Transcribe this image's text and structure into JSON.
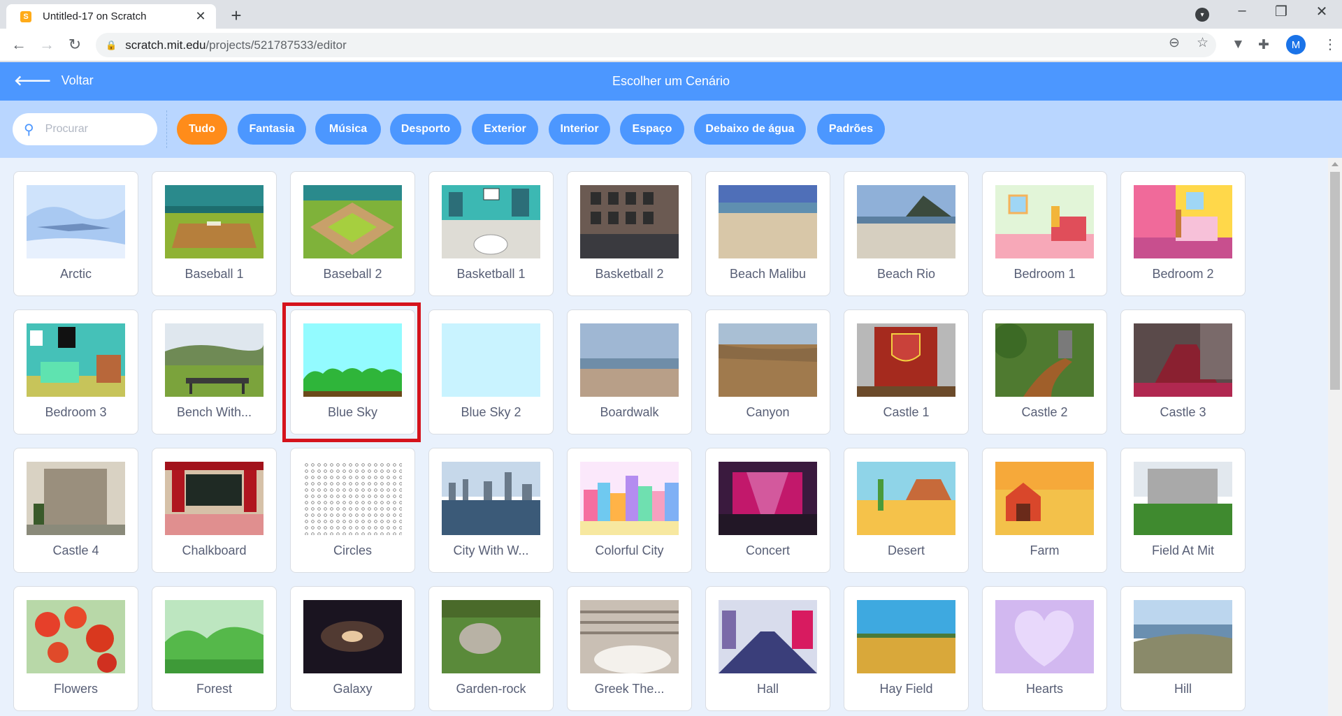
{
  "browser": {
    "tab_title": "Untitled-17 on Scratch",
    "url_host": "scratch.mit.edu",
    "url_path": "/projects/521787533/editor",
    "profile_initial": "M"
  },
  "header": {
    "back_label": "Voltar",
    "title": "Escolher um Cenário"
  },
  "search": {
    "placeholder": "Procurar"
  },
  "filters": [
    {
      "label": "Tudo",
      "active": true
    },
    {
      "label": "Fantasia"
    },
    {
      "label": "Música"
    },
    {
      "label": "Desporto"
    },
    {
      "label": "Exterior"
    },
    {
      "label": "Interior"
    },
    {
      "label": "Espaço"
    },
    {
      "label": "Debaixo de água"
    },
    {
      "label": "Padrões"
    }
  ],
  "selected_backdrop": "Blue Sky",
  "backdrops": [
    {
      "name": "Arctic",
      "icon": "arctic-thumbnail"
    },
    {
      "name": "Baseball 1",
      "icon": "baseball-thumbnail"
    },
    {
      "name": "Baseball 2",
      "icon": "baseball-field-thumbnail"
    },
    {
      "name": "Basketball 1",
      "icon": "basketball-court-thumbnail"
    },
    {
      "name": "Basketball 2",
      "icon": "building-thumbnail"
    },
    {
      "name": "Beach Malibu",
      "icon": "beach-thumbnail"
    },
    {
      "name": "Beach Rio",
      "icon": "beach-thumbnail"
    },
    {
      "name": "Bedroom 1",
      "icon": "bedroom-thumbnail"
    },
    {
      "name": "Bedroom 2",
      "icon": "bedroom-thumbnail"
    },
    {
      "name": "Bedroom 3",
      "icon": "bedroom-thumbnail"
    },
    {
      "name": "Bench With...",
      "icon": "landscape-thumbnail"
    },
    {
      "name": "Blue Sky",
      "icon": "blue-sky-thumbnail"
    },
    {
      "name": "Blue Sky 2",
      "icon": "blue-sky-thumbnail"
    },
    {
      "name": "Boardwalk",
      "icon": "boardwalk-thumbnail"
    },
    {
      "name": "Canyon",
      "icon": "canyon-thumbnail"
    },
    {
      "name": "Castle 1",
      "icon": "castle-door-thumbnail"
    },
    {
      "name": "Castle 2",
      "icon": "castle-thumbnail"
    },
    {
      "name": "Castle 3",
      "icon": "castle-interior-thumbnail"
    },
    {
      "name": "Castle 4",
      "icon": "castle-thumbnail"
    },
    {
      "name": "Chalkboard",
      "icon": "chalkboard-thumbnail"
    },
    {
      "name": "Circles",
      "icon": "circles-pattern-thumbnail"
    },
    {
      "name": "City With W...",
      "icon": "city-thumbnail"
    },
    {
      "name": "Colorful City",
      "icon": "city-thumbnail"
    },
    {
      "name": "Concert",
      "icon": "stage-thumbnail"
    },
    {
      "name": "Desert",
      "icon": "desert-thumbnail"
    },
    {
      "name": "Farm",
      "icon": "farm-thumbnail"
    },
    {
      "name": "Field At Mit",
      "icon": "building-thumbnail"
    },
    {
      "name": "Flowers",
      "icon": "flowers-thumbnail"
    },
    {
      "name": "Forest",
      "icon": "forest-thumbnail"
    },
    {
      "name": "Galaxy",
      "icon": "galaxy-thumbnail"
    },
    {
      "name": "Garden-rock",
      "icon": "garden-thumbnail"
    },
    {
      "name": "Greek The...",
      "icon": "theater-thumbnail"
    },
    {
      "name": "Hall",
      "icon": "hall-thumbnail"
    },
    {
      "name": "Hay Field",
      "icon": "field-thumbnail"
    },
    {
      "name": "Hearts",
      "icon": "heart-thumbnail"
    },
    {
      "name": "Hill",
      "icon": "hill-thumbnail"
    }
  ],
  "colors": {
    "scratch_blue": "#4c97ff",
    "filter_bar": "#b9d6ff",
    "active_chip": "#ff8c1a",
    "selection_ring": "#d5131c"
  }
}
